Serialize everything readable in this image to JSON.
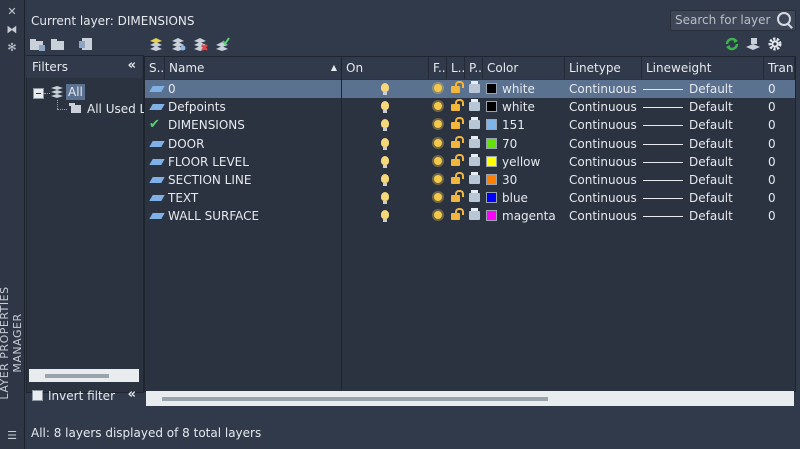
{
  "window": {
    "vertical_title": "LAYER PROPERTIES MANAGER",
    "current_layer_label": "Current layer: DIMENSIONS"
  },
  "search": {
    "placeholder": "Search for layer"
  },
  "filters": {
    "title": "Filters",
    "tree": [
      {
        "label": "All",
        "selected": true
      },
      {
        "label": "All Used L"
      }
    ],
    "invert_label": "Invert filter"
  },
  "columns": [
    "S...",
    "Name",
    "On",
    "F...",
    "L...",
    "P...",
    "Color",
    "Linetype",
    "Lineweight",
    "Trans"
  ],
  "layers": [
    {
      "status": "layer",
      "name": "0",
      "on": true,
      "color_hex": "#000000",
      "color_name": "white",
      "linetype": "Continuous",
      "lineweight": "Default",
      "trans": "0",
      "selected": true
    },
    {
      "status": "layer",
      "name": "Defpoints",
      "on": true,
      "color_hex": "#000000",
      "color_name": "white",
      "linetype": "Continuous",
      "lineweight": "Default",
      "trans": "0",
      "selected": false
    },
    {
      "status": "current",
      "name": "DIMENSIONS",
      "on": true,
      "color_hex": "#7fb4e8",
      "color_name": "151",
      "linetype": "Continuous",
      "lineweight": "Default",
      "trans": "0",
      "selected": false
    },
    {
      "status": "layer",
      "name": "DOOR",
      "on": true,
      "color_hex": "#62e00a",
      "color_name": "70",
      "linetype": "Continuous",
      "lineweight": "Default",
      "trans": "0",
      "selected": false
    },
    {
      "status": "layer",
      "name": "FLOOR LEVEL",
      "on": true,
      "color_hex": "#ffff00",
      "color_name": "yellow",
      "linetype": "Continuous",
      "lineweight": "Default",
      "trans": "0",
      "selected": false
    },
    {
      "status": "layer",
      "name": "SECTION LINE",
      "on": true,
      "color_hex": "#ff7f00",
      "color_name": "30",
      "linetype": "Continuous",
      "lineweight": "Default",
      "trans": "0",
      "selected": false
    },
    {
      "status": "layer",
      "name": "TEXT",
      "on": true,
      "color_hex": "#0000ff",
      "color_name": "blue",
      "linetype": "Continuous",
      "lineweight": "Default",
      "trans": "0",
      "selected": false
    },
    {
      "status": "layer",
      "name": "WALL SURFACE",
      "on": true,
      "color_hex": "#ff00ff",
      "color_name": "magenta",
      "linetype": "Continuous",
      "lineweight": "Default",
      "trans": "0",
      "selected": false
    }
  ],
  "status_bar": "All: 8 layers displayed of 8 total layers",
  "colors": {
    "accent": "#5b7190",
    "refresh": "#3ab54a"
  }
}
